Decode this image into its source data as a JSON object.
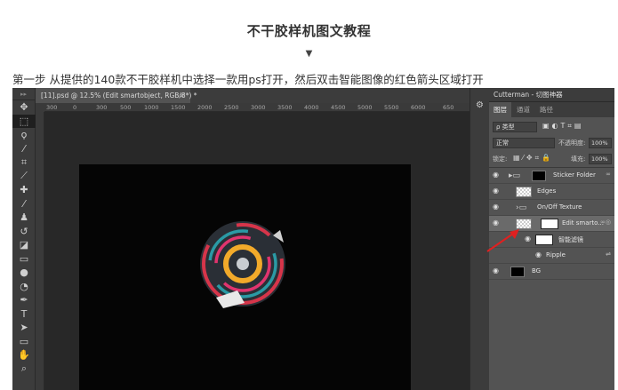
{
  "article": {
    "title": "不干胶样机图文教程",
    "arrow": "▼",
    "step1": "第一步 从提供的140款不干胶样机中选择一款用ps打开，然后双击智能图像的红色箭头区域打开"
  },
  "photoshop": {
    "doc_tab": "[11].psd @ 12.5% (Edit smartobject, RGB/8*) *",
    "doc_tab_close": "×",
    "ruler_ticks": [
      "300",
      "0",
      "300",
      "500",
      "1000",
      "1500",
      "2000",
      "2500",
      "3000",
      "3500",
      "4000",
      "4500",
      "5000",
      "5500",
      "6000",
      "650"
    ],
    "tools_icons": [
      "move-icon",
      "marquee-icon",
      "lasso-icon",
      "magic-wand-icon",
      "crop-icon",
      "eyedropper-icon",
      "healing-icon",
      "brush-icon",
      "stamp-icon",
      "history-brush-icon",
      "eraser-icon",
      "gradient-icon",
      "blur-icon",
      "dodge-icon",
      "pen-icon",
      "type-icon",
      "path-select-icon",
      "shape-icon",
      "hand-icon",
      "zoom-icon"
    ],
    "panel": {
      "header": "Cutterman - 切图神器",
      "tabs": [
        "图层",
        "通道",
        "路径"
      ],
      "filter_kind": "ρ 类型",
      "blend_mode": "正常",
      "opacity_label": "不透明度:",
      "opacity_value": "100%",
      "lock_label": "锁定:",
      "fill_label": "填充:",
      "fill_value": "100%",
      "layers": [
        {
          "name": "Sticker Folder"
        },
        {
          "name": "Edges"
        },
        {
          "name": "On/Off Texture"
        },
        {
          "name": "Edit smarto..."
        },
        {
          "name": "智能滤镜"
        },
        {
          "name": "Ripple"
        },
        {
          "name": "BG"
        }
      ]
    }
  },
  "colors": {
    "annotation_arrow": "#e02020",
    "ring_red": "#d6354a",
    "ring_pink": "#e0346e",
    "ring_teal": "#2a9aa5",
    "ring_yellow": "#f2aa2a"
  }
}
